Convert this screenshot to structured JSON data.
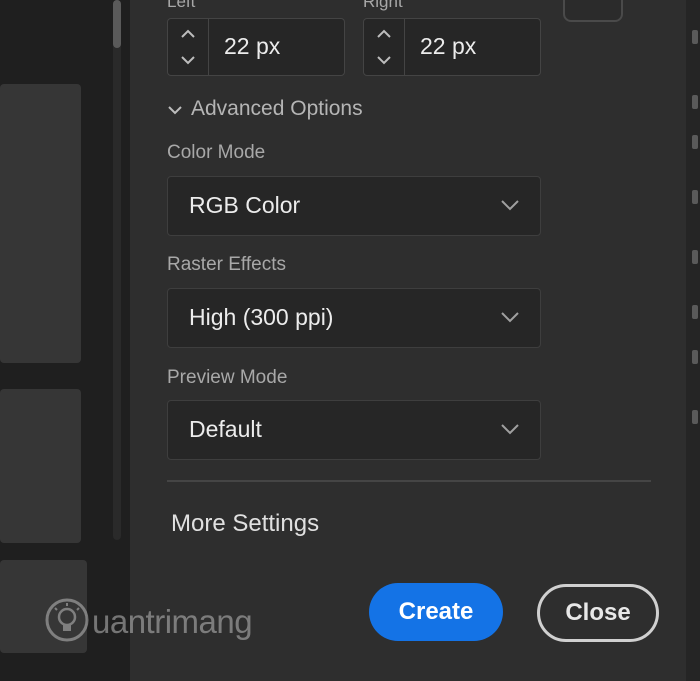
{
  "margins": {
    "left_label": "Left",
    "right_label": "Right",
    "left_value": "22 px",
    "right_value": "22 px"
  },
  "advanced": {
    "toggle_label": "Advanced Options",
    "color_mode": {
      "label": "Color Mode",
      "value": "RGB Color"
    },
    "raster_effects": {
      "label": "Raster Effects",
      "value": "High (300 ppi)"
    },
    "preview_mode": {
      "label": "Preview Mode",
      "value": "Default"
    }
  },
  "more_settings_label": "More Settings",
  "actions": {
    "create_label": "Create",
    "close_label": "Close"
  },
  "watermark": "uantrimang",
  "colors": {
    "panel_bg": "#2e2e2e",
    "accent": "#1473e6"
  }
}
